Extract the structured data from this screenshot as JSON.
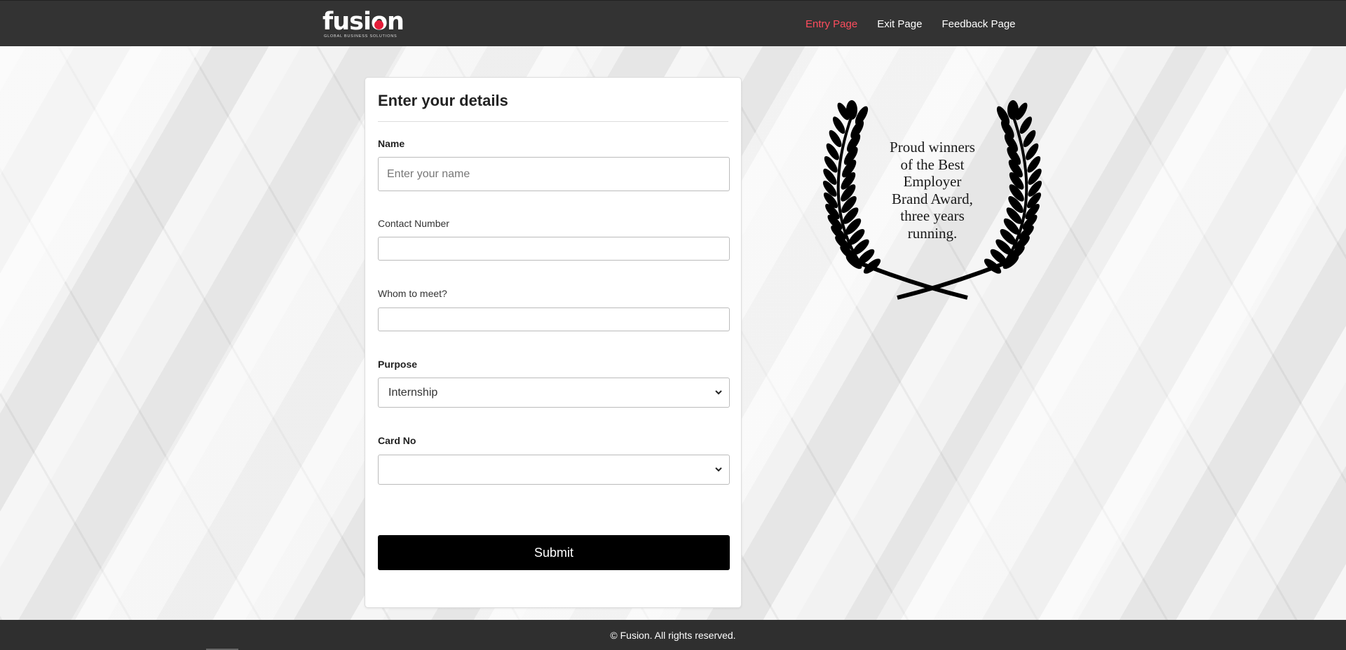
{
  "header": {
    "logo": {
      "word": "fusion",
      "tagline": "GLOBAL BUSINESS SOLUTIONS"
    },
    "nav": [
      {
        "label": "Entry Page",
        "active": true
      },
      {
        "label": "Exit Page",
        "active": false
      },
      {
        "label": "Feedback Page",
        "active": false
      }
    ],
    "colors": {
      "bar": "#333333",
      "active_link": "#ff4d5e",
      "logo_dot": "#e41c38"
    }
  },
  "form": {
    "title": "Enter your details",
    "name": {
      "label": "Name",
      "placeholder": "Enter your name",
      "value": ""
    },
    "contact": {
      "label": "Contact Number",
      "value": ""
    },
    "whom": {
      "label": "Whom to meet?",
      "value": ""
    },
    "purpose": {
      "label": "Purpose",
      "selected": "Internship"
    },
    "card_no": {
      "label": "Card No",
      "selected": ""
    },
    "submit_label": "Submit"
  },
  "award": {
    "text_lines": [
      "Proud winners",
      "of the Best",
      "Employer",
      "Brand Award,",
      "three years",
      "running."
    ],
    "icon": "laurel-wreath-icon"
  },
  "footer": {
    "text": "© Fusion. All rights reserved."
  }
}
